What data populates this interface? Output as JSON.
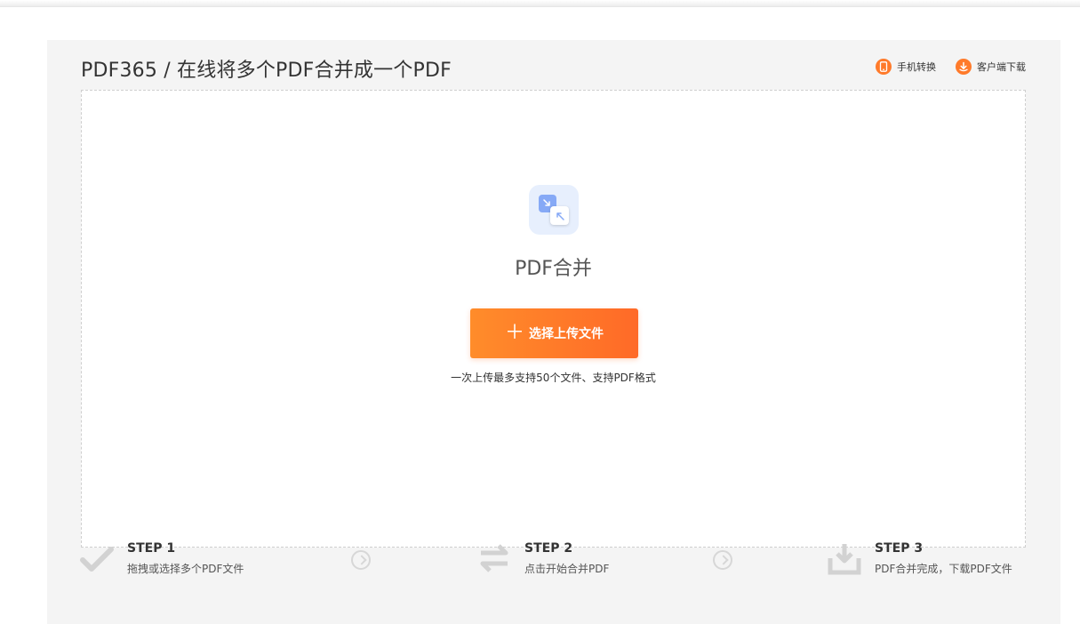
{
  "header": {
    "title": "PDF365 / 在线将多个PDF合并成一个PDF",
    "links": [
      {
        "label": "手机转换",
        "icon": "phone-icon"
      },
      {
        "label": "客户端下载",
        "icon": "download-icon"
      }
    ]
  },
  "tool": {
    "name": "PDF合并",
    "upload_button": "选择上传文件",
    "upload_note": "一次上传最多支持50个文件、支持PDF格式"
  },
  "steps": [
    {
      "title": "STEP 1",
      "desc": "拖拽或选择多个PDF文件",
      "icon": "check-icon"
    },
    {
      "title": "STEP 2",
      "desc": "点击开始合并PDF",
      "icon": "swap-icon"
    },
    {
      "title": "STEP 3",
      "desc": "PDF合并完成，下载PDF文件",
      "icon": "download-tray-icon"
    }
  ],
  "colors": {
    "accent": "#ff7a2a",
    "panel_bg": "#f4f4f4",
    "icon_blue": "#86a9f6"
  }
}
